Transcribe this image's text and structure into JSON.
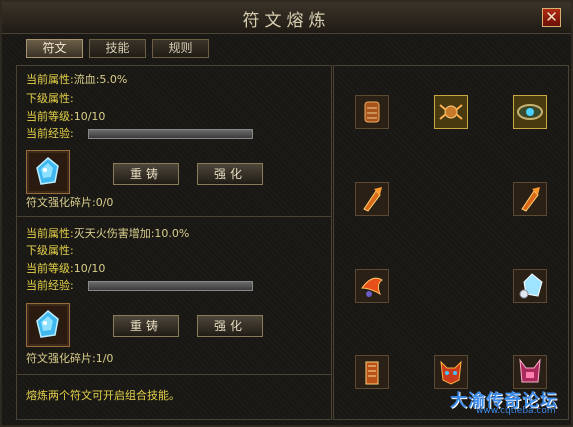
{
  "window": {
    "title": "符文熔炼",
    "close_symbol": "✕"
  },
  "tabs": [
    {
      "label": "符文",
      "active": true
    },
    {
      "label": "技能",
      "active": false
    },
    {
      "label": "规则",
      "active": false
    }
  ],
  "rune1": {
    "current_attr_label": "当前属性:",
    "current_attr_value": "流血:5.0%",
    "next_attr_label": "下级属性:",
    "level_label": "当前等级:",
    "level_value": "10/10",
    "exp_label": "当前经验:",
    "exp_fill": 0,
    "recast_label": "重铸",
    "strengthen_label": "强化",
    "fragments_label": "符文强化碎片:",
    "fragments_value": "0/0"
  },
  "rune2": {
    "current_attr_label": "当前属性:",
    "current_attr_value": "灭天火伤害增加:10.0%",
    "next_attr_label": "下级属性:",
    "level_label": "当前等级:",
    "level_value": "10/10",
    "exp_label": "当前经验:",
    "exp_fill": 0,
    "recast_label": "重铸",
    "strengthen_label": "强化",
    "fragments_label": "符文强化碎片:",
    "fragments_value": "1/0"
  },
  "footer_note": "熔炼两个符文可开启组合技能。",
  "watermark": {
    "text": "大渝传奇论坛",
    "url": "www.cqtieba.com"
  },
  "colors": {
    "label_yellow": "#e4d24a",
    "value_tan": "#d8ce8c",
    "border": "#4a4234",
    "watermark_blue": "#3b8ae8"
  }
}
